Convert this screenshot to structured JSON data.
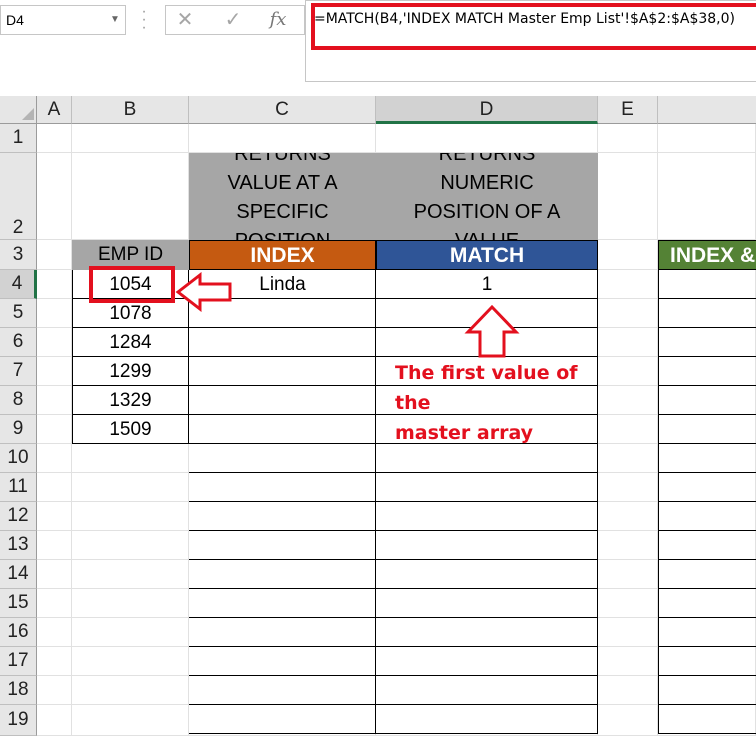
{
  "formula_bar": {
    "name_box": "D4",
    "fx": "fx",
    "formula": "=MATCH(B4,'INDEX MATCH Master Emp List'!$A$2:$A$38,0)"
  },
  "columns": [
    "A",
    "B",
    "C",
    "D",
    "E"
  ],
  "rows": [
    "1",
    "2",
    "3",
    "4",
    "5",
    "6",
    "7",
    "8",
    "9",
    "10",
    "11",
    "12",
    "13",
    "14",
    "15",
    "16",
    "17",
    "18",
    "19"
  ],
  "header_cells": {
    "c2_lines": [
      "RETURNS",
      "VALUE AT A",
      "SPECIFIC",
      "POSITION"
    ],
    "d2_lines": [
      "RETURNS",
      "NUMERIC",
      "POSITION OF A",
      "VALUE"
    ],
    "b3": "EMP ID",
    "c3": "INDEX",
    "d3": "MATCH",
    "f3": "INDEX &"
  },
  "emp_ids": [
    "1054",
    "1078",
    "1284",
    "1299",
    "1329",
    "1509"
  ],
  "c4": "Linda",
  "d4": "1",
  "annotation": [
    "The first value of the",
    "master array"
  ],
  "colors": {
    "index_header": "#c55a11",
    "match_header": "#2f5597",
    "index_match_header": "#548235",
    "highlight": "#e3101e",
    "grey_header": "#a6a6a6"
  }
}
